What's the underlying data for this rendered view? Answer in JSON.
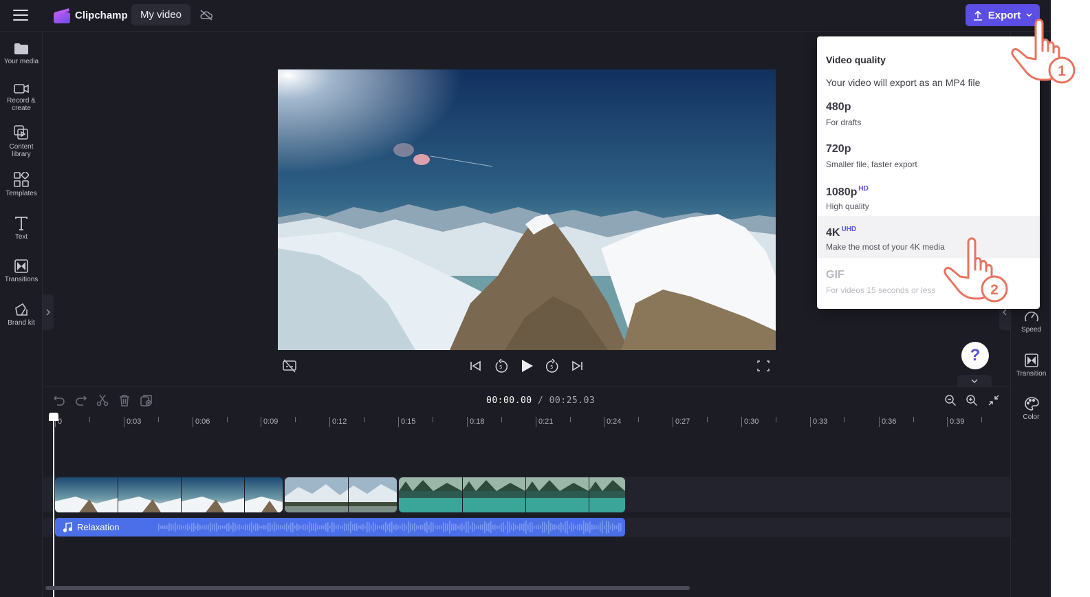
{
  "app": {
    "name": "Clipchamp",
    "project_title": "My video",
    "export_label": "Export"
  },
  "sidebar": {
    "items": [
      {
        "label": "Your media",
        "icon": "folder-icon"
      },
      {
        "label": "Record & create",
        "icon": "camera-icon"
      },
      {
        "label": "Content library",
        "icon": "library-icon"
      },
      {
        "label": "Templates",
        "icon": "templates-icon"
      },
      {
        "label": "Text",
        "icon": "text-icon"
      },
      {
        "label": "Transitions",
        "icon": "transitions-icon"
      },
      {
        "label": "Brand kit",
        "icon": "brand-kit-icon"
      }
    ]
  },
  "right_panel": {
    "items": [
      {
        "label": "Speed",
        "icon": "speedometer-icon"
      },
      {
        "label": "Transition",
        "icon": "transition-icon"
      },
      {
        "label": "Color",
        "icon": "palette-icon"
      }
    ]
  },
  "help": {
    "glyph": "?"
  },
  "timeline": {
    "current_time": "00:00.00",
    "separator": "/",
    "total_time": "00:25.03",
    "ruler": [
      "0",
      "0:03",
      "0:06",
      "0:09",
      "0:12",
      "0:15",
      "0:18",
      "0:21",
      "0:24",
      "0:27",
      "0:30",
      "0:33",
      "0:36",
      "0:39"
    ],
    "audio_clip_name": "Relaxation"
  },
  "export_menu": {
    "heading": "Video quality",
    "subheading": "Your video will export as an MP4 file",
    "options": [
      {
        "title": "480p",
        "badge": "",
        "desc": "For drafts"
      },
      {
        "title": "720p",
        "badge": "",
        "desc": "Smaller file, faster export"
      },
      {
        "title": "1080p",
        "badge": "HD",
        "desc": "High quality"
      },
      {
        "title": "4K",
        "badge": "UHD",
        "desc": "Make the most of your 4K media"
      },
      {
        "title": "GIF",
        "badge": "",
        "desc": "For videos 15 seconds or less"
      }
    ]
  },
  "annotations": {
    "step1": "1",
    "step2": "2"
  },
  "colors": {
    "accent": "#5b4ee4",
    "background": "#1c1c25",
    "audio_clip": "#4a6fe8",
    "annotation": "#e8735e"
  }
}
